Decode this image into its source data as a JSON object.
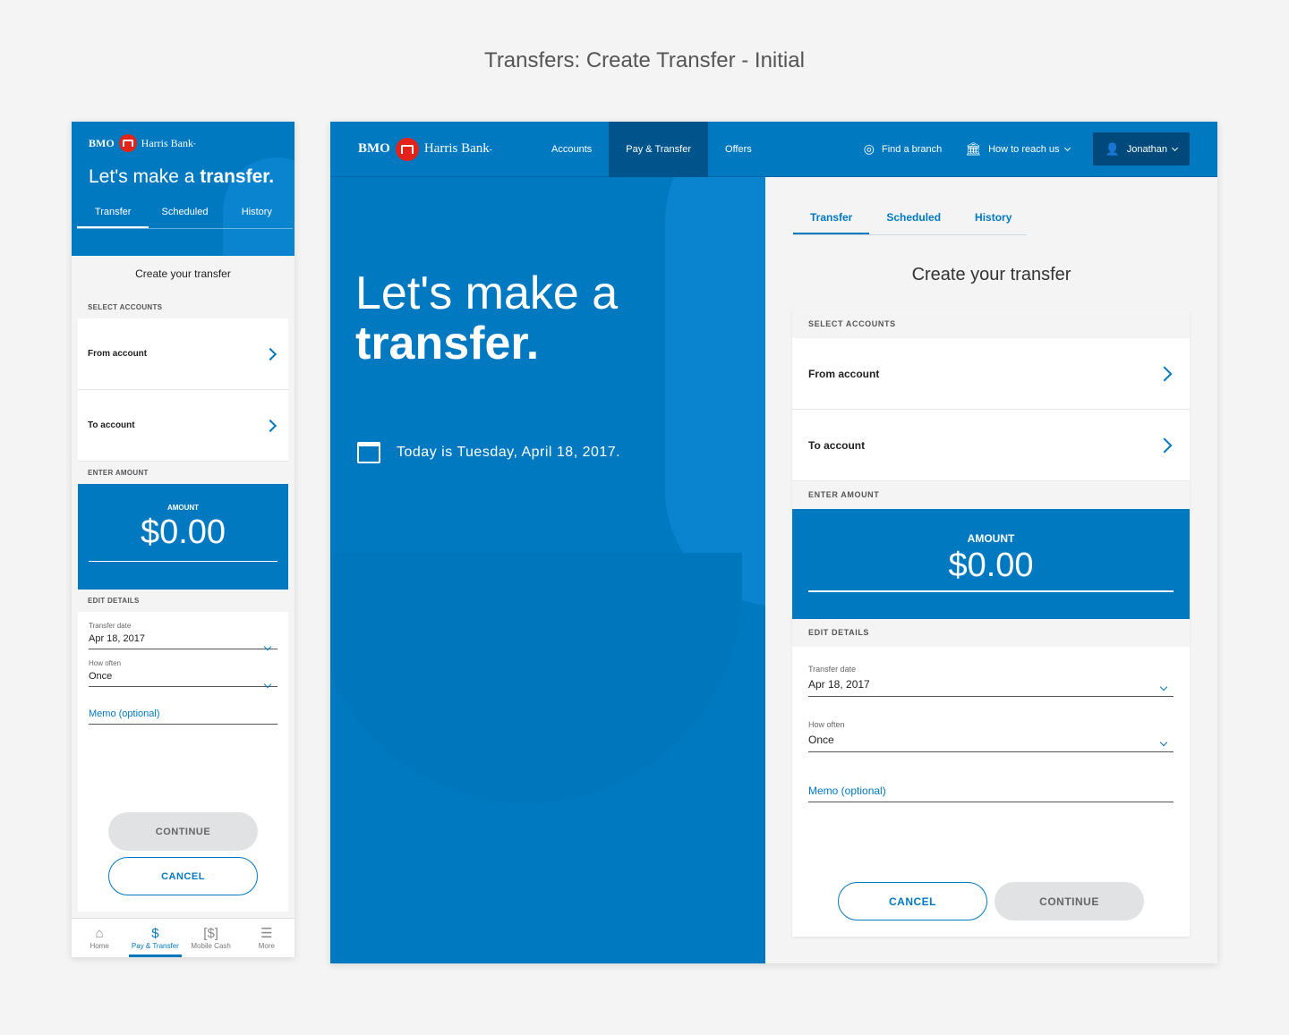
{
  "page_title": "Transfers: Create Transfer - Initial",
  "brand": {
    "name": "BMO",
    "bank": "Harris Bank",
    "tm": "-",
    "primary_color": "#0079c1",
    "roundel_color": "#e2231a"
  },
  "hero": {
    "light": "Let's make a",
    "bold": "transfer."
  },
  "date_text": "Today is Tuesday, April 18, 2017.",
  "tabs": [
    "Transfer",
    "Scheduled",
    "History"
  ],
  "nav": {
    "links": [
      "Accounts",
      "Pay & Transfer",
      "Offers"
    ],
    "find_branch": "Find a branch",
    "reach_us": "How to reach us",
    "user": "Jonathan"
  },
  "form": {
    "title": "Create your transfer",
    "select_accounts": "SELECT ACCOUNTS",
    "from_account": "From account",
    "to_account": "To account",
    "enter_amount": "ENTER AMOUNT",
    "amount_label": "AMOUNT",
    "amount_value": "$0.00",
    "edit_details": "EDIT DETAILS",
    "transfer_date_label": "Transfer date",
    "transfer_date_value": "Apr 18, 2017",
    "how_often_label": "How often",
    "how_often_value": "Once",
    "memo": "Memo (optional)",
    "continue": "CONTINUE",
    "cancel": "CANCEL"
  },
  "mobile_nav": [
    {
      "label": "Home",
      "icon": "home-icon"
    },
    {
      "label": "Pay & Transfer",
      "icon": "dollar-icon"
    },
    {
      "label": "Mobile Cash",
      "icon": "mobile-cash-icon"
    },
    {
      "label": "More",
      "icon": "menu-icon"
    }
  ]
}
